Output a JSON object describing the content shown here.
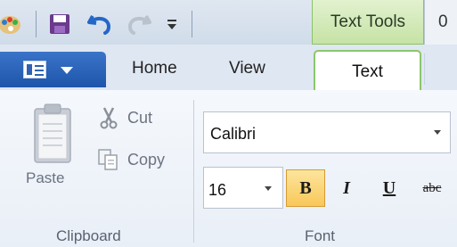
{
  "title_bar": {
    "context_tab_label": "Text Tools",
    "truncated_title": "0"
  },
  "quick_access": {
    "icons": [
      "paint-app-icon",
      "save-icon",
      "undo-icon",
      "redo-icon",
      "customize-dropdown-icon"
    ]
  },
  "tabs": {
    "file_menu": "paint-menu",
    "items": [
      {
        "label": "Home"
      },
      {
        "label": "View"
      },
      {
        "label": "Text",
        "active": true
      }
    ]
  },
  "clipboard": {
    "paste_label": "Paste",
    "cut_label": "Cut",
    "copy_label": "Copy",
    "group_label": "Clipboard"
  },
  "font": {
    "family": "Calibri",
    "size": "16",
    "bold_label": "B",
    "italic_label": "I",
    "underline_label": "U",
    "strikethrough_label": "abc",
    "group_label": "Font",
    "bold_active": true
  },
  "colors": {
    "context_tab": "#c6e3a5",
    "file_tab": "#1d55aa",
    "pressed": "#f8c858"
  }
}
